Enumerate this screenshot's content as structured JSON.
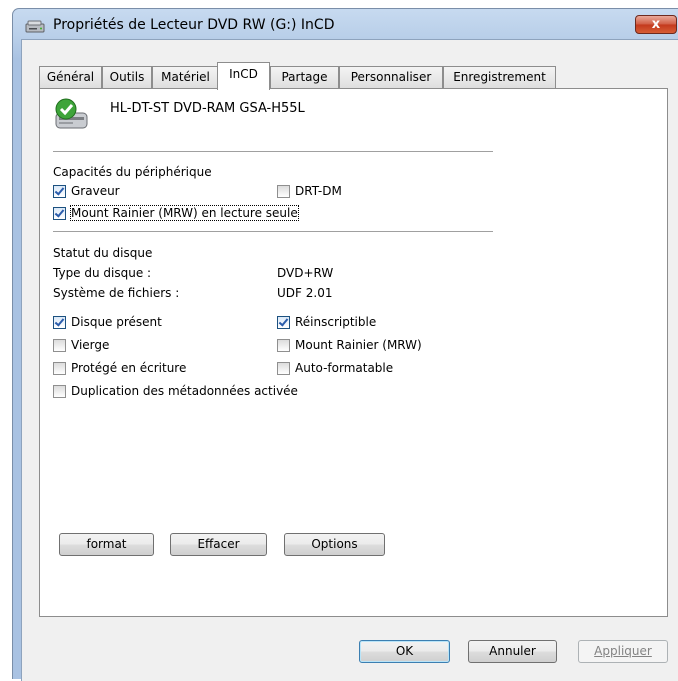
{
  "window": {
    "title": "Propriétés de Lecteur DVD RW (G:) InCD",
    "close_label": "x"
  },
  "tabs": [
    {
      "label": "Général"
    },
    {
      "label": "Outils"
    },
    {
      "label": "Matériel"
    },
    {
      "label": "InCD"
    },
    {
      "label": "Partage"
    },
    {
      "label": "Personnaliser"
    },
    {
      "label": "Enregistrement"
    }
  ],
  "active_tab": "InCD",
  "device": {
    "name": "HL-DT-ST DVD-RAM GSA-H55L"
  },
  "capabilities": {
    "title": "Capacités du périphérique",
    "items": [
      {
        "label": "Graveur",
        "checked": true
      },
      {
        "label": "DRT-DM",
        "checked": false
      },
      {
        "label": "Mount Rainier (MRW) en lecture seule",
        "checked": true
      }
    ]
  },
  "disc_status": {
    "title": "Statut du disque",
    "disc_type_label": "Type du disque :",
    "disc_type_value": "DVD+RW",
    "filesystem_label": "Système de fichiers :",
    "filesystem_value": "UDF 2.01",
    "flags": [
      {
        "label": "Disque présent",
        "checked": true
      },
      {
        "label": "Réinscriptible",
        "checked": true
      },
      {
        "label": "Vierge",
        "checked": false
      },
      {
        "label": "Mount Rainier (MRW)",
        "checked": false
      },
      {
        "label": "Protégé en écriture",
        "checked": false
      },
      {
        "label": "Auto-formatable",
        "checked": false
      },
      {
        "label": "Duplication des métadonnées activée",
        "checked": false
      }
    ]
  },
  "actions": {
    "format_label": "format",
    "erase_label": "Effacer",
    "options_label": "Options"
  },
  "dialog_buttons": {
    "ok_label": "OK",
    "cancel_label": "Annuler",
    "apply_label": "Appliquer"
  }
}
